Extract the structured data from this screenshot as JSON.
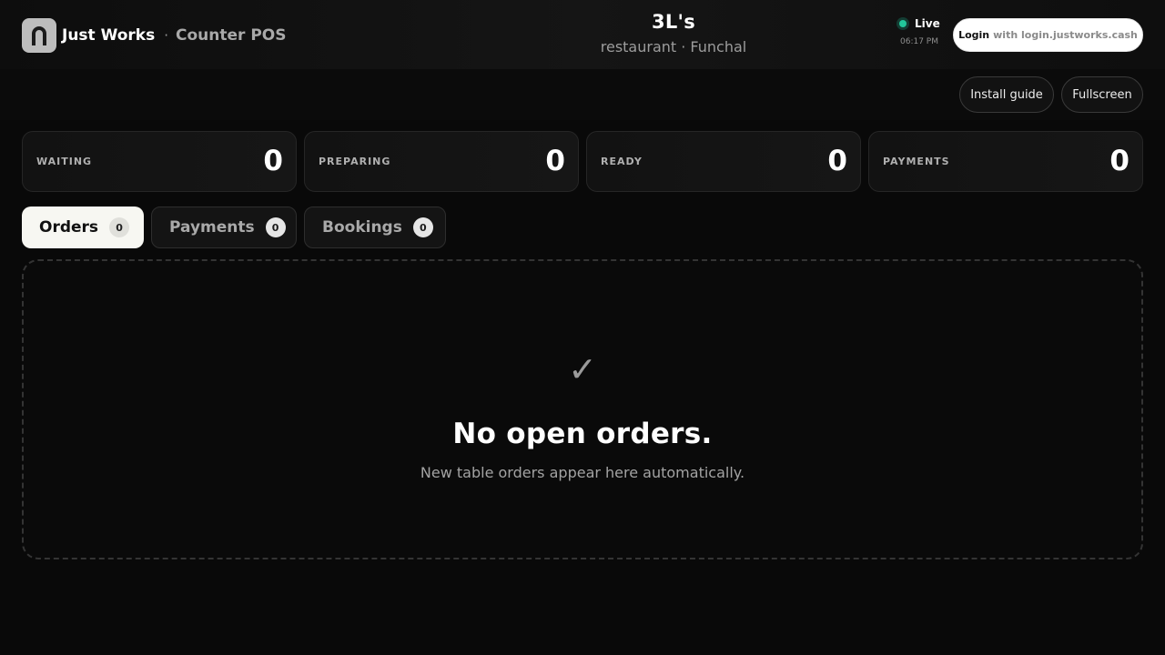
{
  "brand": {
    "name": "Just Works",
    "separator": "·",
    "product": "Counter POS",
    "logo_icon": "arch-logo-icon"
  },
  "venue": {
    "name": "3L's",
    "subtitle": "restaurant · Funchal"
  },
  "status": {
    "live_label": "Live",
    "live_color": "#22c79a",
    "time": "06:17 PM"
  },
  "login": {
    "label": "Login",
    "suffix": "with login.justworks.cash"
  },
  "actions": {
    "install_label": "Install guide",
    "fullscreen_label": "Fullscreen"
  },
  "stats": [
    {
      "label": "WAITING",
      "value": "0"
    },
    {
      "label": "PREPARING",
      "value": "0"
    },
    {
      "label": "READY",
      "value": "0"
    },
    {
      "label": "PAYMENTS",
      "value": "0"
    }
  ],
  "tabs": [
    {
      "label": "Orders",
      "count": "0",
      "active": true
    },
    {
      "label": "Payments",
      "count": "0",
      "active": false
    },
    {
      "label": "Bookings",
      "count": "0",
      "active": false
    }
  ],
  "empty_state": {
    "icon": "✓",
    "title": "No open orders.",
    "subtitle": "New table orders appear here automatically."
  }
}
